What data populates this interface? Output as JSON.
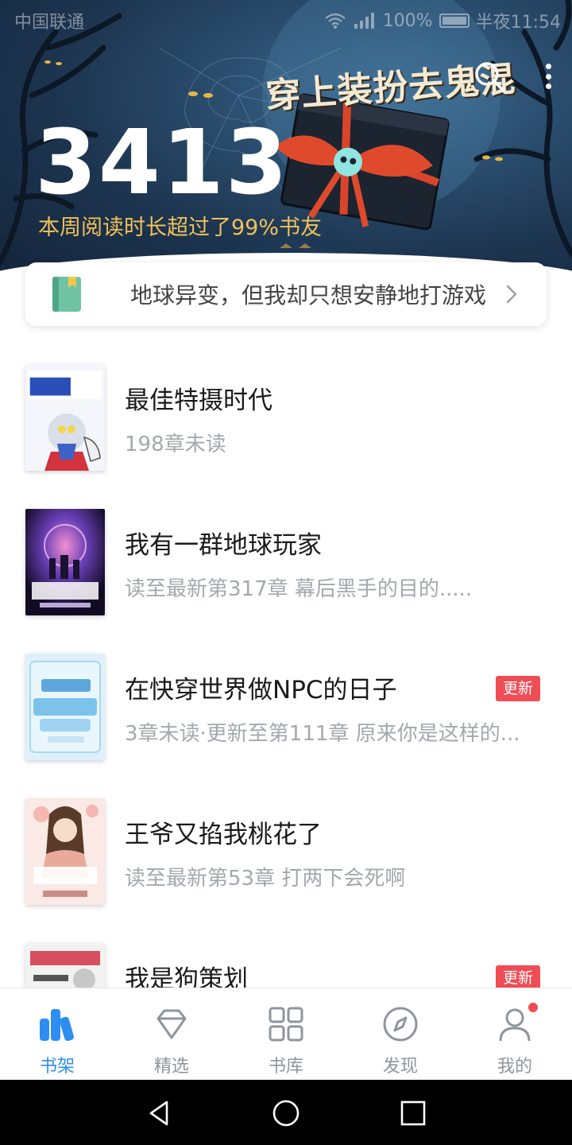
{
  "status_bar": {
    "carrier": "中国联通",
    "battery": "100%",
    "time": "半夜11:54"
  },
  "header": {
    "promo_title": "穿上装扮去鬼混",
    "stats_value": "3413",
    "stats_subtitle": "本周阅读时长超过了99%书友"
  },
  "continue_reading": {
    "title": "地球异变，但我却只想安静地打游戏"
  },
  "books": [
    {
      "title": "最佳特摄时代",
      "subtitle": "198章未读",
      "badge": ""
    },
    {
      "title": "我有一群地球玩家",
      "subtitle": "读至最新第317章 幕后黑手的目的.....",
      "badge": ""
    },
    {
      "title": "在快穿世界做NPC的日子",
      "subtitle": "3章未读·更新至第111章 原来你是这样的...",
      "badge": "更新"
    },
    {
      "title": "王爷又掐我桃花了",
      "subtitle": "读至最新第53章 打两下会死啊",
      "badge": ""
    },
    {
      "title": "我是狗策划",
      "subtitle": "",
      "badge": "更新"
    }
  ],
  "bottom_nav": [
    {
      "label": "书架",
      "icon": "bookshelf-icon",
      "active": true
    },
    {
      "label": "精选",
      "icon": "diamond-icon",
      "active": false
    },
    {
      "label": "书库",
      "icon": "grid-icon",
      "active": false
    },
    {
      "label": "发现",
      "icon": "compass-icon",
      "active": false
    },
    {
      "label": "我的",
      "icon": "user-icon",
      "active": false
    }
  ],
  "colors": {
    "accent": "#2c8ef0",
    "badge": "#f04c55",
    "stats_subtitle": "#f0c15a"
  }
}
